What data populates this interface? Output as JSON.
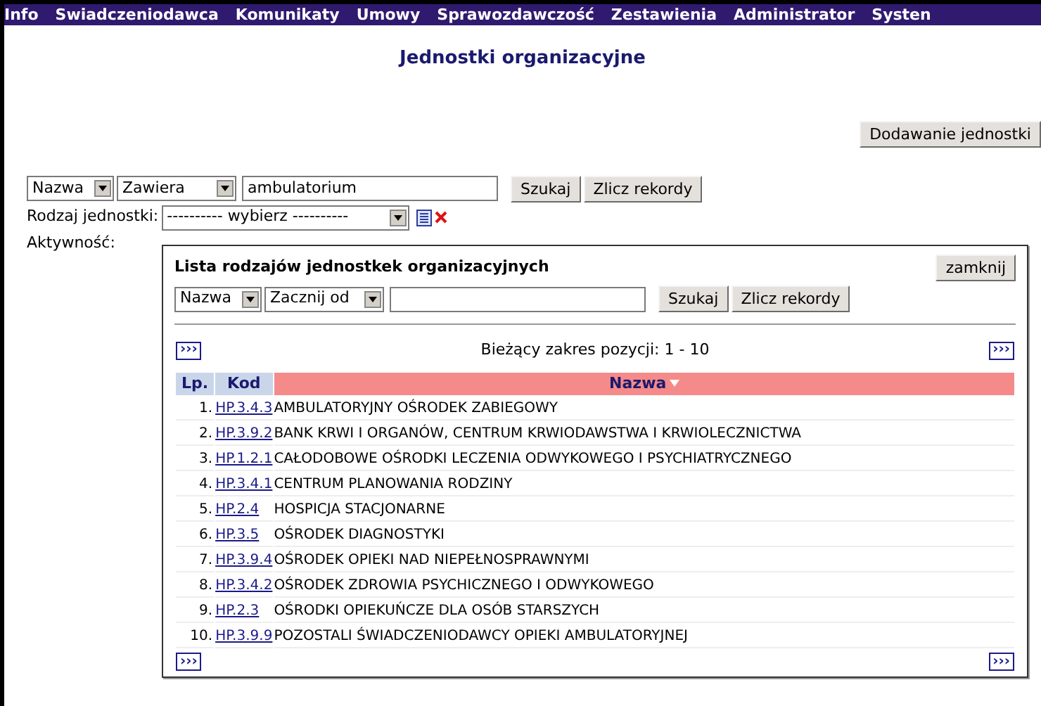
{
  "menu": [
    "Info",
    "Swiadczeniodawca",
    "Komunikaty",
    "Umowy",
    "Sprawozdawczość",
    "Zestawienia",
    "Administrator",
    "Systen"
  ],
  "title": "Jednostki organizacyjne",
  "add_button": "Dodawanie jednostki",
  "search": {
    "field": "Nazwa",
    "mode": "Zawiera",
    "value": "ambulatorium",
    "search_button": "Szukaj",
    "count_button": "Zlicz rekordy"
  },
  "unit_type": {
    "label": "Rodzaj jednostki:",
    "value": "---------- wybierz ----------"
  },
  "activity": {
    "label": "Aktywność:"
  },
  "popup": {
    "title": "Lista rodzajów jednostkek organizacyjnych",
    "close_button": "zamknij",
    "search": {
      "field": "Nazwa",
      "mode": "Zacznij od",
      "search_button": "Szukaj",
      "count_button": "Zlicz rekordy"
    },
    "next_top_left": "›››",
    "range": "Bieżący zakres pozycji: 1 - 10",
    "next_top_right": "›››",
    "columns": [
      {
        "label": "Lp.",
        "sorted": false
      },
      {
        "label": "Kod",
        "sorted": false
      },
      {
        "label": "Nazwa",
        "sorted": true
      }
    ],
    "rows": [
      {
        "lp": "1.",
        "code": "HP.3.4.3",
        "name": "AMBULATORYJNY OŚRODEK ZABIEGOWY"
      },
      {
        "lp": "2.",
        "code": "HP.3.9.2",
        "name": "BANK KRWI I ORGANÓW, CENTRUM KRWIODAWSTWA I KRWIOLECZNICTWA"
      },
      {
        "lp": "3.",
        "code": "HP.1.2.1",
        "name": "CAŁODOBOWE OŚRODKI LECZENIA ODWYKOWEGO I PSYCHIATRYCZNEGO"
      },
      {
        "lp": "4.",
        "code": "HP.3.4.1",
        "name": "CENTRUM PLANOWANIA RODZINY"
      },
      {
        "lp": "5.",
        "code": "HP.2.4",
        "name": "HOSPICJA STACJONARNE"
      },
      {
        "lp": "6.",
        "code": "HP.3.5",
        "name": "OŚRODEK DIAGNOSTYKI"
      },
      {
        "lp": "7.",
        "code": "HP.3.9.4",
        "name": "OŚRODEK OPIEKI NAD NIEPEŁNOSPRAWNYMI"
      },
      {
        "lp": "8.",
        "code": "HP.3.4.2",
        "name": "OŚRODEK ZDROWIA PSYCHICZNEGO I ODWYKOWEGO"
      },
      {
        "lp": "9.",
        "code": "HP.2.3",
        "name": "OŚRODKI OPIEKUŃCZE DLA OSÓB STARSZYCH"
      },
      {
        "lp": "10.",
        "code": "HP.3.9.9",
        "name": "POZOSTALI ŚWIADCZENIODAWCY OPIEKI AMBULATORYJNEJ"
      }
    ],
    "next_bottom_left": "›››",
    "next_bottom_right": "›››"
  }
}
